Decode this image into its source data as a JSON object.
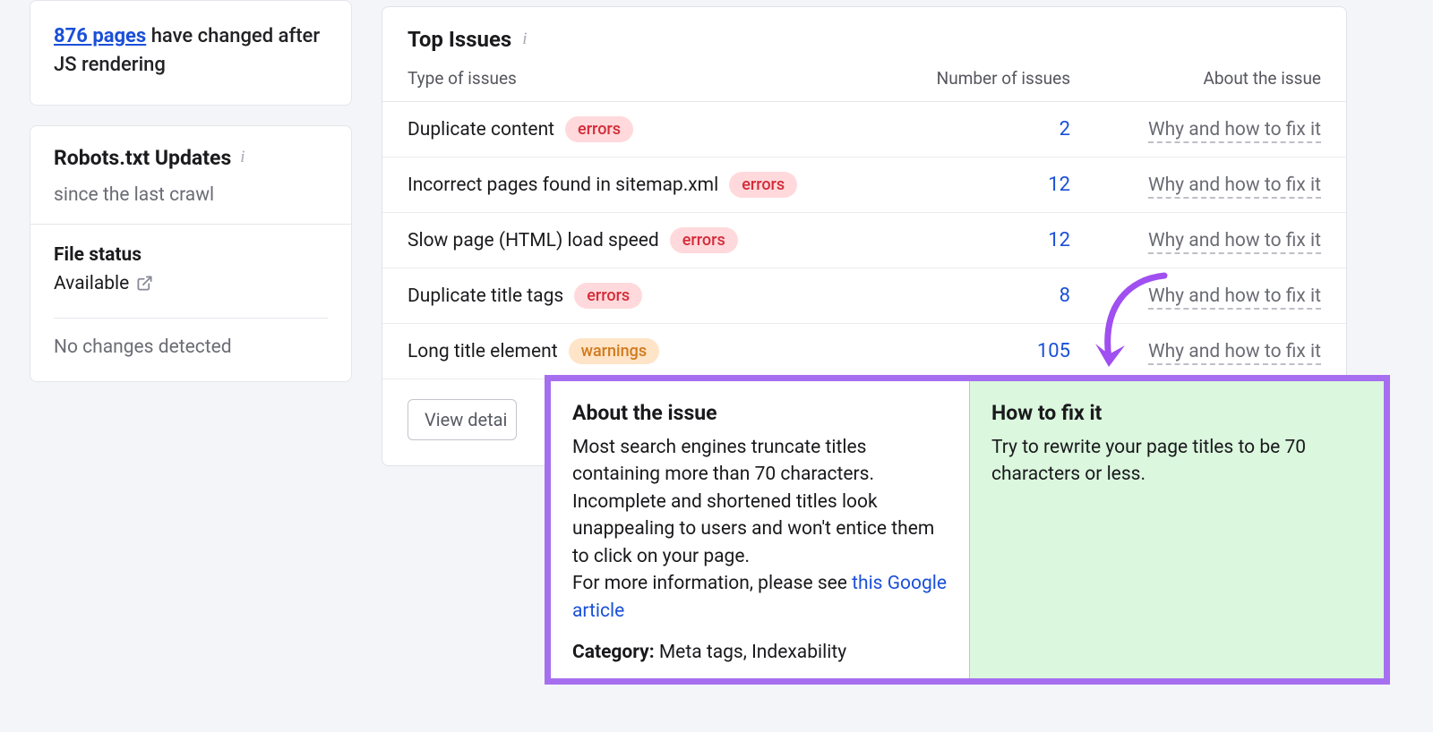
{
  "left_card": {
    "pages_count_text": "876 pages",
    "changed_text": " have changed after JS rendering"
  },
  "robots_card": {
    "title": "Robots.txt Updates",
    "subtitle": "since the last crawl",
    "status_label": "File status",
    "status_value": "Available",
    "no_changes": "No changes detected"
  },
  "main": {
    "title": "Top Issues",
    "col_type": "Type of issues",
    "col_number": "Number of issues",
    "col_about": "About the issue",
    "view_details": "View detai",
    "why_fix": "Why and how to fix it",
    "badge_errors": "errors",
    "badge_warnings": "warnings",
    "issues": [
      {
        "name": "Duplicate content",
        "badge": "errors",
        "count": "2"
      },
      {
        "name": "Incorrect pages found in sitemap.xml",
        "badge": "errors",
        "count": "12"
      },
      {
        "name": "Slow page (HTML) load speed",
        "badge": "errors",
        "count": "12"
      },
      {
        "name": "Duplicate title tags",
        "badge": "errors",
        "count": "8"
      },
      {
        "name": "Long title element",
        "badge": "warnings",
        "count": "105"
      }
    ]
  },
  "popup": {
    "about_title": "About the issue",
    "about_body1": "Most search engines truncate titles containing more than 70 characters. Incomplete and shortened titles look unappealing to users and won't entice them to click on your page.",
    "about_body2a": "For more information, please see ",
    "about_link": "this Google article",
    "category_label": "Category:",
    "category_value": " Meta tags, Indexability",
    "fix_title": "How to fix it",
    "fix_body": "Try to rewrite your page titles to be 70 characters or less."
  }
}
